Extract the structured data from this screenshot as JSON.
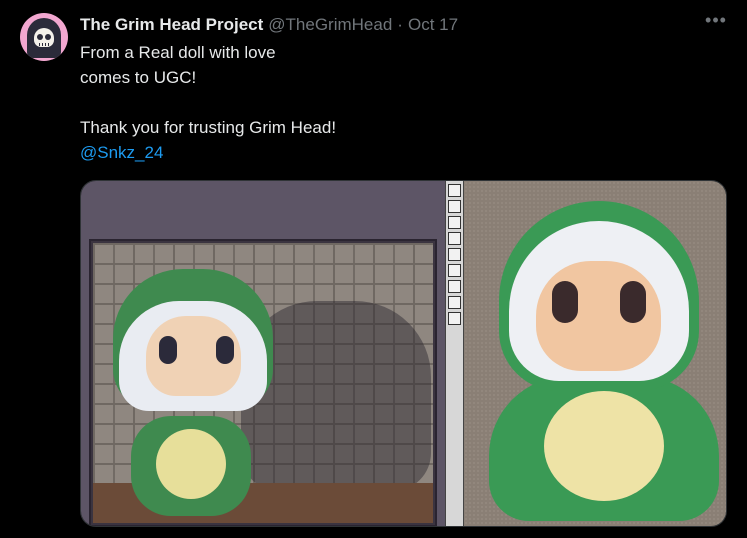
{
  "tweet": {
    "author_name": "The Grim Head Project",
    "author_handle": "@TheGrimHead",
    "separator": "·",
    "date": "Oct 17",
    "more_icon": "•••",
    "lines": [
      "From a Real doll with love",
      "comes to UGC!",
      "",
      "Thank you for trusting Grim Head!"
    ],
    "mention": "@Snkz_24"
  },
  "colors": {
    "background": "#000000",
    "text": "#e7e9ea",
    "secondary": "#71767b",
    "link": "#1d9bf0",
    "avatar_bg": "#f2a7d0"
  },
  "icons": {
    "more": "more-horizontal-icon",
    "avatar": "grim-skull-avatar"
  }
}
